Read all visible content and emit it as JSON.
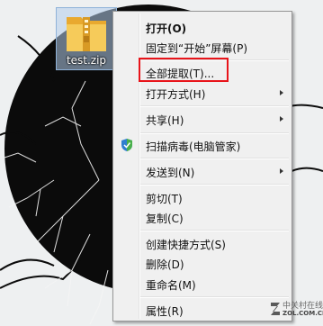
{
  "desktop": {
    "file_name": "test.zip"
  },
  "context_menu": {
    "open": "打开(O)",
    "pin_to_start": "固定到“开始”屏幕(P)",
    "extract_all": "全部提取(T)...",
    "open_with": "打开方式(H)",
    "share": "共享(H)",
    "scan_virus": "扫描病毒(电脑管家)",
    "send_to": "发送到(N)",
    "cut": "剪切(T)",
    "copy": "复制(C)",
    "create_shortcut": "创建快捷方式(S)",
    "delete": "删除(D)",
    "rename": "重命名(M)",
    "properties": "属性(R)"
  },
  "watermark": {
    "top": "中关村在线",
    "bottom": "ZOL.COM.CN"
  },
  "colors": {
    "highlight_border": "#e8141a",
    "menu_background": "#f0f0f0",
    "folder_yellow": "#f2c14e"
  },
  "icons": {
    "zip_file": "zip-folder-icon",
    "submenu": "chevron-right-icon",
    "security_shield": "shield-icon"
  }
}
